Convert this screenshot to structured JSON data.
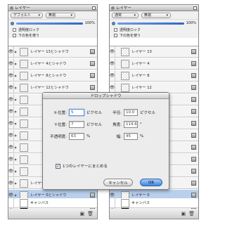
{
  "panels": [
    {
      "title": "レイヤー",
      "mode": "デフォルト",
      "mode2": "無視",
      "opacity": "100%",
      "lock_label": "透明度ロック",
      "below_label": "下の色を使う",
      "layers": [
        "レイヤー 13とシャドウ",
        "レイヤー 4とシャドウ",
        "レイヤー 8とシャドウ",
        "レイヤー 12とシャドウ",
        "",
        "",
        "",
        "",
        "",
        "",
        "",
        "レイヤー 9とシャドウ",
        "レイヤー 0とシャドウ",
        ""
      ],
      "canvas_label": "キャンバス"
    },
    {
      "title": "レイヤー",
      "mode": "通常",
      "mode2": "無視",
      "opacity": "100%",
      "lock_label": "透明度ロック",
      "below_label": "下の色を使う",
      "layers": [
        "レイヤー 13",
        "レイヤー 4",
        "レイヤー 8",
        "レイヤー 12",
        "",
        "",
        "",
        "",
        "",
        "",
        "",
        "レイヤー 9",
        "レイヤー 0",
        ""
      ],
      "canvas_label": "キャンバス"
    }
  ],
  "dialog": {
    "title": "ドロップシャドウ",
    "x_label": "X-位置:",
    "x_value": "5",
    "x_unit": "ピクセル",
    "y_label": "Y-位置:",
    "y_value": "7",
    "y_unit": "ピクセル",
    "opacity_label": "不透明度:",
    "opacity_value": "63",
    "opacity_unit": "%",
    "radius_label": "半径:",
    "radius_value": "10.0",
    "radius_unit": "ピクセル",
    "angle_label": "角度:",
    "angle_value": "114.6",
    "angle_unit": "°",
    "width_label": "幅:",
    "width_value": "45",
    "width_unit": "%",
    "checkbox_label": "1つのレイヤーにまとめる",
    "checkbox_checked": true,
    "cancel_label": "キャンセル",
    "ok_label": "OK"
  },
  "colors": {
    "selected_row": "#b8cfee",
    "ok_button": "#3d86de"
  }
}
